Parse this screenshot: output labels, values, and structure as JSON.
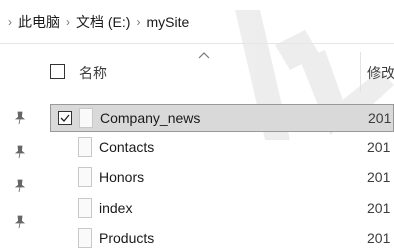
{
  "breadcrumb": {
    "items": [
      {
        "label": "此电脑"
      },
      {
        "label": "文档 (E:)"
      },
      {
        "label": "mySite"
      }
    ]
  },
  "columns": {
    "name": "名称",
    "modified": "修改"
  },
  "files": [
    {
      "name": "Company_news",
      "date": "201",
      "selected": true,
      "checked": true
    },
    {
      "name": "Contacts",
      "date": "201",
      "selected": false,
      "checked": false
    },
    {
      "name": "Honors",
      "date": "201",
      "selected": false,
      "checked": false
    },
    {
      "name": "index",
      "date": "201",
      "selected": false,
      "checked": false
    },
    {
      "name": "Products",
      "date": "201",
      "selected": false,
      "checked": false
    }
  ],
  "icons": {
    "breadcrumb_separator": "chevron-right-icon",
    "pin": "pin-icon",
    "file": "file-icon",
    "sort": "sort-chevron-icon"
  },
  "colors": {
    "selected_row_bg": "#d9d9d9",
    "selected_row_border": "#999999"
  }
}
